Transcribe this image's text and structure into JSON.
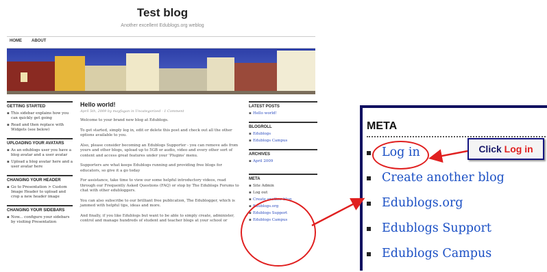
{
  "blog": {
    "title": "Test blog",
    "tagline": "Another excellent Edublogs.org weblog",
    "nav": [
      "HOME",
      "ABOUT"
    ]
  },
  "left_sidebar": [
    {
      "heading": "GETTING STARTED",
      "items": [
        {
          "text": "This sidebar explains how you can quickly get going"
        },
        {
          "text": "Read and then replace with Widgets (see below)"
        }
      ]
    },
    {
      "heading": "UPLOADING YOUR AVATARS",
      "items": [
        {
          "text": "As an edublogs user you have a blog avatar and a user avatar"
        },
        {
          "text": "Upload a blog avatar here and a user avatar here"
        }
      ]
    },
    {
      "heading": "CHANGING YOUR HEADER",
      "items": [
        {
          "text": "Go to Presentation > Custom Image Header to upload and crop a new header image"
        }
      ]
    },
    {
      "heading": "CHANGING YOUR SIDEBARS",
      "items": [
        {
          "text": "Now... configure your sidebars by visiting Presentation"
        }
      ]
    }
  ],
  "post": {
    "title": "Hello world!",
    "meta": "April 5th, 2009 by mayfagan in Uncategorized · 1 Comment",
    "paragraphs": [
      "Welcome to your brand new blog at Edublogs.",
      "To get started, simply log in, edit or delete this post and check out all the other options available to you.",
      "Also, please consider becoming an Edublogs Supporter - you can remove ads from yours and other blogs, upload up to 5GB or audio, video and every other sort of content and access great features under your 'Plugins' menu.",
      "Supporters are what keeps Edublogs running and providing free blogs for educators, so give it a go today",
      "For assistance, take time to view our some helpful introductory videos, read through our Frequently Asked Questions (FAQ) or stop by The Edublogs Forums to chat with other edubloggers.",
      "You can also subscribe to our brilliant free publication, The Edublogger, which is jammed with helpful tips, ideas and more.",
      "And finally, if you like Edublogs but want to be able to simply create, administer, control and manage hundreds of student and teacher blogs at your school or"
    ]
  },
  "right_sidebar": [
    {
      "heading": "LATEST POSTS",
      "items": [
        "Hello world!"
      ]
    },
    {
      "heading": "BLOGROLL",
      "items": [
        "Edublogs",
        "Edublogs Campus"
      ]
    },
    {
      "heading": "ARCHIVES",
      "items": [
        "April 2009"
      ]
    },
    {
      "heading": "META",
      "items": [
        "Site Admin",
        "Log out",
        "Create another blog",
        "Edublogs.org",
        "Edublogs Support",
        "Edublogs Campus"
      ]
    }
  ],
  "zoom_meta": {
    "heading": "META",
    "items": [
      "Log in",
      "Create another blog",
      "Edublogs.org",
      "Edublogs Support",
      "Edublogs Campus"
    ]
  },
  "callout": {
    "prefix": "Click ",
    "highlight": "Log in"
  },
  "colors": {
    "link": "#1a4fc4",
    "annotation": "#e02020",
    "frame": "#101060"
  }
}
